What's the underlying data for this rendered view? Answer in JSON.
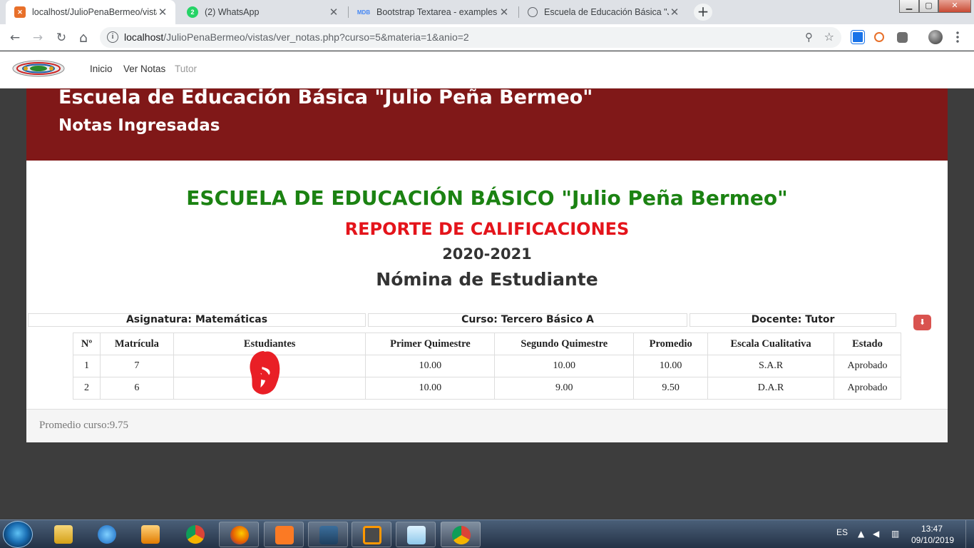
{
  "browser": {
    "tabs": [
      {
        "title": "localhost/JulioPenaBermeo/vista",
        "icon": "xampp-icon",
        "color": "#e8702a"
      },
      {
        "title": "(2) WhatsApp",
        "icon": "whatsapp-icon",
        "color": "#25d366",
        "badge": "2"
      },
      {
        "title": "Bootstrap Textarea - examples &",
        "icon": "mdb-icon",
        "color": "#4285f4",
        "badge": "MDB"
      },
      {
        "title": "Escuela de Educación Básica \"Julio",
        "icon": "globe-icon",
        "color": "#5f6368"
      }
    ],
    "new_tab": "+",
    "window_controls": {
      "minimize": "▁",
      "maximize": "▢",
      "close": "✕"
    },
    "url_host": "localhost",
    "url_path": "/JulioPenaBermeo/vistas/ver_notas.php?curso=5&materia=1&anio=2",
    "icons": {
      "back": "←",
      "forward": "→",
      "reload": "↻",
      "home": "⌂",
      "info": "i",
      "zoom": "⚲",
      "bookmark": "☆"
    }
  },
  "site": {
    "nav": [
      {
        "label": "Inicio"
      },
      {
        "label": "Ver Notas"
      },
      {
        "label": "Tutor"
      }
    ],
    "hero_title": "Escuela de Educación Básica \"Julio Peña Bermeo\"",
    "hero_subtitle": "Notas Ingresadas",
    "school_name": "ESCUELA DE EDUCACIÓN BÁSICO \"Julio Peña Bermeo\"",
    "report_title": "REPORTE DE CALIFICACIONES",
    "school_year": "2020-2021",
    "roster_title": "Nómina de Estudiante",
    "info": {
      "subject": "Asignatura: Matemáticas",
      "course": "Curso: Tercero Básico A",
      "teacher": "Docente: Tutor"
    },
    "download_icon": "⬇",
    "table": {
      "headers": [
        "Nº",
        "Matrícula",
        "Estudiantes",
        "Primer Quimestre",
        "Segundo Quimestre",
        "Promedio",
        "Escala Cualitativa",
        "Estado"
      ],
      "rows": [
        [
          "1",
          "7",
          "",
          "10.00",
          "10.00",
          "10.00",
          "S.A.R",
          "Aprobado"
        ],
        [
          "2",
          "6",
          "",
          "10.00",
          "9.00",
          "9.50",
          "D.A.R",
          "Aprobado"
        ]
      ]
    },
    "course_average": "Promedio curso:9.75"
  },
  "colors": {
    "hero_bg": "#801818",
    "school_name": "#1b8212",
    "report_title": "#e4141b",
    "download_btn": "#d9534f"
  },
  "taskbar": {
    "language": "ES",
    "time": "13:47",
    "date": "09/10/2019",
    "apps": [
      "windows-explorer-icon",
      "internet-explorer-icon",
      "media-player-icon",
      "chrome-icon",
      "firefox-icon",
      "xampp-icon",
      "mysql-workbench-icon",
      "sublime-text-icon",
      "notepad-icon",
      "chrome-active-icon"
    ]
  }
}
